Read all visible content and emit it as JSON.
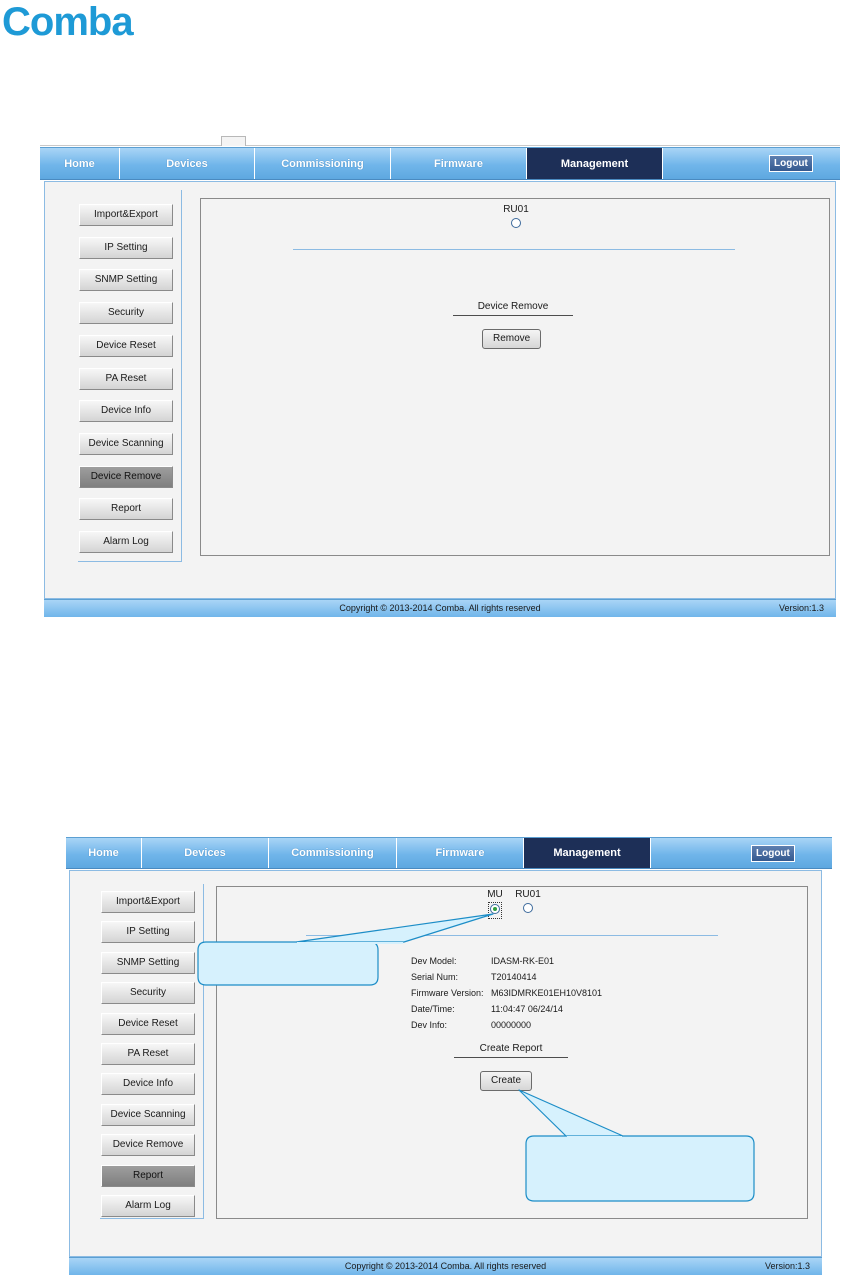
{
  "brand": {
    "name": "Comba",
    "color": "#1e9ad6"
  },
  "nav": {
    "tabs": [
      "Home",
      "Devices",
      "Commissioning",
      "Firmware",
      "Management"
    ],
    "active": "Management",
    "logout_label": "Logout"
  },
  "sidebar_items": [
    "Import&Export",
    "IP Setting",
    "SNMP Setting",
    "Security",
    "Device Reset",
    "PA Reset",
    "Device Info",
    "Device Scanning",
    "Device Remove",
    "Report",
    "Alarm Log"
  ],
  "screen1": {
    "active_menu": "Device Remove",
    "devices": [
      {
        "label": "RU01",
        "selected": false
      }
    ],
    "section_title": "Device Remove",
    "action_label": "Remove"
  },
  "screen2": {
    "active_menu": "Report",
    "devices": [
      {
        "label": "MU",
        "selected": true
      },
      {
        "label": "RU01",
        "selected": false
      }
    ],
    "info": [
      {
        "label": "Dev Model:",
        "value": "IDASM-RK-E01"
      },
      {
        "label": "Serial Num:",
        "value": "T20140414"
      },
      {
        "label": "Firmware Version:",
        "value": "M63IDMRKE01EH10V8101"
      },
      {
        "label": "Date/Time:",
        "value": "11:04:47 06/24/14"
      },
      {
        "label": "Dev Info:",
        "value": "00000000"
      }
    ],
    "section_title": "Create Report",
    "action_label": "Create"
  },
  "footer": {
    "copyright": "Copyright © 2013-2014 Comba. All rights reserved",
    "version": "Version:1.3"
  },
  "colors": {
    "nav_gradient_top": "#a9d5f6",
    "nav_gradient_bottom": "#5ea8e0",
    "nav_active": "#1d2f57",
    "callout_fill": "#d6f1fd",
    "callout_border": "#1c8dc7",
    "panel_bg": "#f3f3f3"
  }
}
